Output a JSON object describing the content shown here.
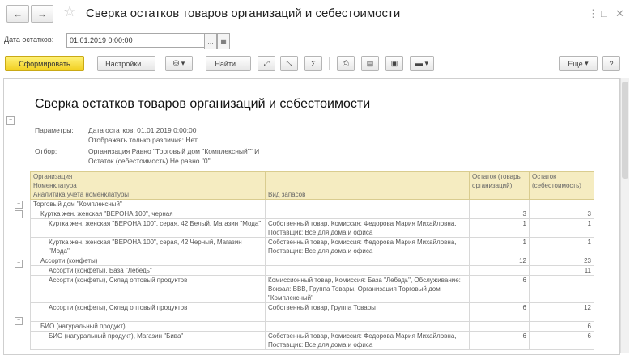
{
  "window": {
    "title": "Сверка остатков товаров организаций и себестоимости"
  },
  "nav": {
    "back_label": "←",
    "forward_label": "→"
  },
  "params": {
    "date_label": "Дата остатков:",
    "date_value": "01.01.2019  0:00:00"
  },
  "toolbar": {
    "generate_label": "Сформировать",
    "settings_label": "Настройки...",
    "find_label": "Найти...",
    "more_label": "Еще"
  },
  "report": {
    "title": "Сверка остатков товаров организаций и себестоимости",
    "params_label": "Параметры:",
    "params_line1": "Дата остатков: 01.01.2019 0:00:00",
    "params_line2": "Отображать только различия: Нет",
    "filter_label": "Отбор:",
    "filter_line1": "Организация Равно \"Торговый дом \"Комплексный\"\" И",
    "filter_line2": "Остаток (себестоимость) Не равно \"0\"",
    "headers": {
      "col1_line1": "Организация",
      "col1_line2": "Номенклатура",
      "col1_line3": "Аналитика учета номенклатуры",
      "col2": "Вид запасов",
      "col3": "Остаток (товары организаций)",
      "col4": "Остаток (себестоимость)"
    },
    "rows": [
      {
        "level": 0,
        "c1": "Торговый дом \"Комплексный\"",
        "c2": "",
        "c3": "",
        "c4": ""
      },
      {
        "level": 1,
        "c1": "Куртка жен. женская \"ВЕРОНА 100\", черная",
        "c2": "",
        "c3": "3",
        "c4": "3"
      },
      {
        "level": 2,
        "c1": "Куртка жен. женская \"ВЕРОНА 100\", серая, 42 Белый, Магазин \"Мода\"",
        "c2": "Собственный товар, Комиссия: Федорова Мария Михайловна, Поставщик: Все для дома и офиса",
        "c3": "1",
        "c4": "1"
      },
      {
        "level": 2,
        "c1": "Куртка жен. женская \"ВЕРОНА 100\", серая, 42 Черный, Магазин \"Мода\"",
        "c2": "Собственный товар, Комиссия: Федорова Мария Михайловна, Поставщик: Все для дома и офиса",
        "c3": "1",
        "c4": "1"
      },
      {
        "level": 1,
        "c1": "Ассорти (конфеты)",
        "c2": "",
        "c3": "12",
        "c4": "23"
      },
      {
        "level": 2,
        "c1": "Ассорти (конфеты), База \"Лебедь\"",
        "c2": "",
        "c3": "",
        "c4": "11"
      },
      {
        "level": 2,
        "c1": "Ассорти (конфеты), Склад оптовый продуктов",
        "c2": "Комиссионный товар, Комиссия: База \"Лебедь\", Обслуживание: Вокзал: ВВВ, Группа Товары, Организация Торговый дом \"Комплексный\"",
        "c3": "6",
        "c4": ""
      },
      {
        "level": 2,
        "c1": "Ассорти (конфеты), Склад оптовый продуктов",
        "c2": "Собственный товар, Группа Товары",
        "c3": "6",
        "c4": "12"
      },
      {
        "level": 1,
        "c1": "БИО (натуральный продукт)",
        "c2": "",
        "c3": "",
        "c4": "6"
      },
      {
        "level": 2,
        "c1": "БИО (натуральный продукт), Магазин \"Бива\"",
        "c2": "Собственный товар, Комиссия: Федорова Мария Михайловна, Поставщик: Все для дома и офиса",
        "c3": "6",
        "c4": "6"
      }
    ]
  }
}
